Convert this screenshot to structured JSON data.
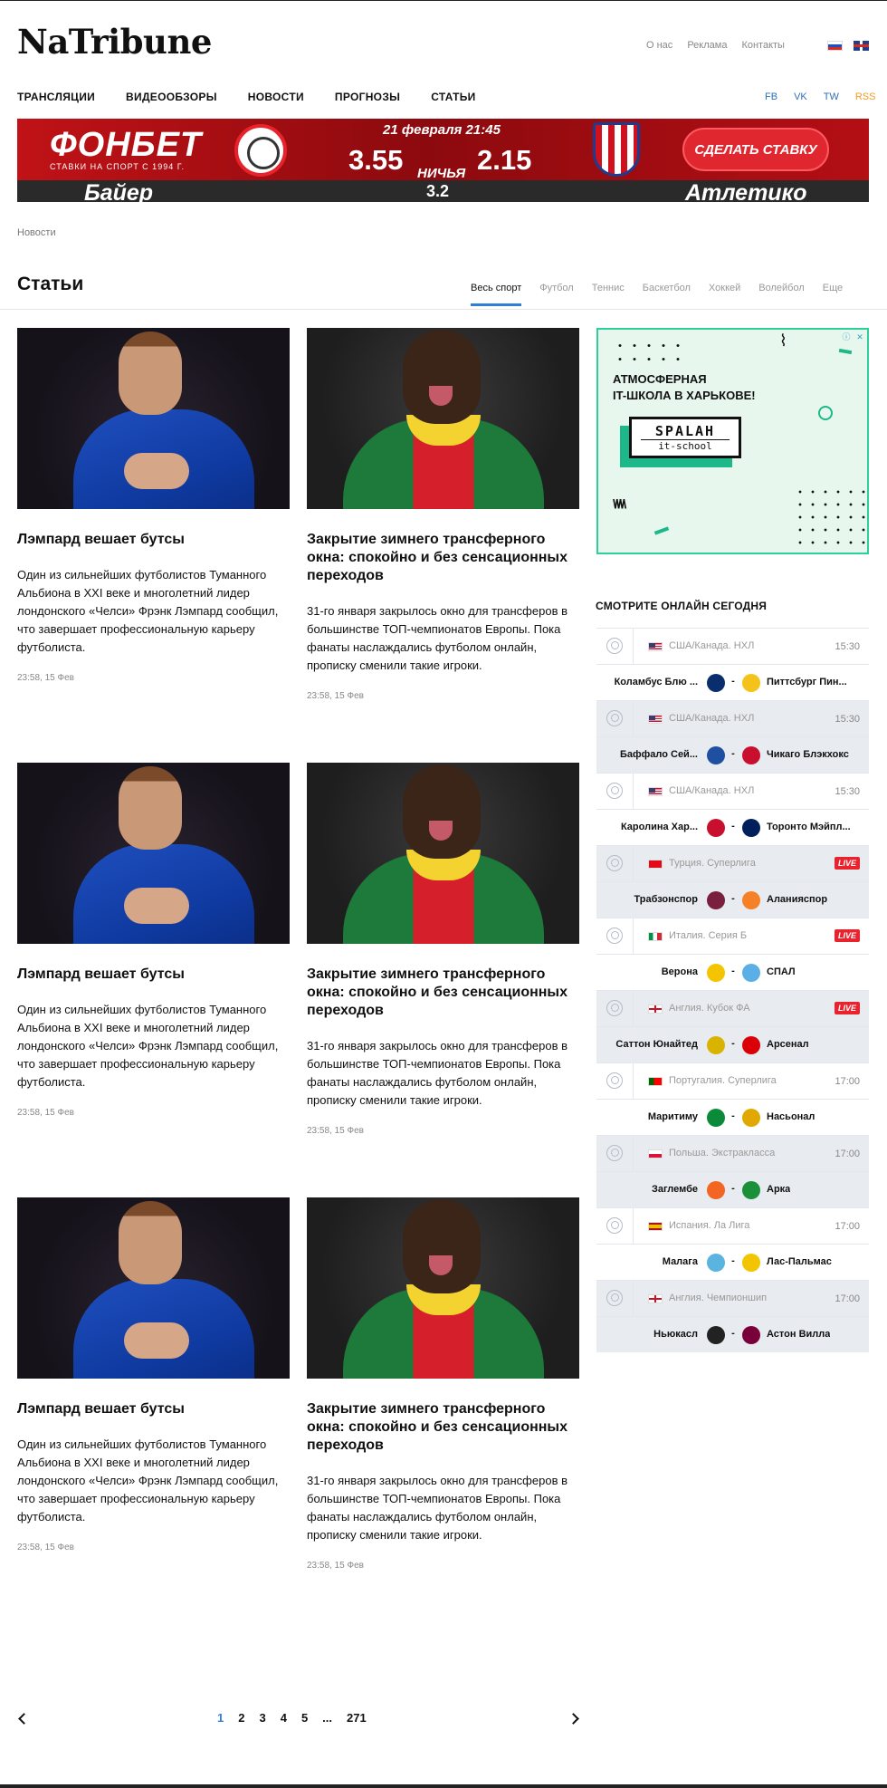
{
  "site": {
    "logo": "NaTribune"
  },
  "toplinks": [
    "О нас",
    "Реклама",
    "Контакты"
  ],
  "languages": [
    "ru-flag",
    "en-flag"
  ],
  "nav": [
    "ТРАНСЛЯЦИИ",
    "ВИДЕООБЗОРЫ",
    "НОВОСТИ",
    "ПРОГНОЗЫ",
    "СТАТЬИ"
  ],
  "social": {
    "fb": "FB",
    "vk": "VK",
    "tw": "TW",
    "rss": "RSS"
  },
  "colors": {
    "accent": "#2f7fd8",
    "live": "#e8232e",
    "rss": "#f29a1f",
    "social": "#2f6fb5",
    "ad_border": "#2fcf9c"
  },
  "banner": {
    "brand": "ФОНБЕТ",
    "sub": "СТАВКИ НА СПОРТ С 1994 Г.",
    "date": "21 февраля 21:45",
    "odd_home": "3.55",
    "odd_away": "2.15",
    "draw_label": "НИЧЬЯ",
    "draw_odd": "3.2",
    "team_home": "Байер",
    "team_away": "Атлетико",
    "cta": "СДЕЛАТЬ СТАВКУ"
  },
  "breadcrumb": "Новости",
  "section": {
    "title": "Статьи",
    "tabs": [
      "Весь спорт",
      "Футбол",
      "Теннис",
      "Баскетбол",
      "Хоккей",
      "Волейбол",
      "Еще"
    ]
  },
  "articles": [
    {
      "image": "lampard-photo",
      "title": "Лэмпард вешает бутсы",
      "text": "Один из сильнейших футболистов Туманного Альбиона в XXI веке и многолетний лидер лондонского «Челси» Фрэнк Лэмпард сообщил, что завершает профессиональную карьеру футболиста.",
      "time": "23:58, 15 Фев"
    },
    {
      "image": "footballer-photo",
      "title": "Закрытие зимнего трансферного окна: спокойно и без сенсационных переходов",
      "text": "31-го января закрылось окно для трансферов в большинстве ТОП-чемпионатов Европы. Пока фанаты наслаждались футболом онлайн, прописку сменили такие игроки.",
      "time": "23:58, 15 Фев"
    },
    {
      "image": "lampard-photo",
      "title": "Лэмпард вешает бутсы",
      "text": "Один из сильнейших футболистов Туманного Альбиона в XXI веке и многолетний лидер лондонского «Челси» Фрэнк Лэмпард сообщил, что завершает профессиональную карьеру футболиста.",
      "time": "23:58, 15 Фев"
    },
    {
      "image": "footballer-photo",
      "title": "Закрытие зимнего трансферного окна: спокойно и без сенсационных переходов",
      "text": "31-го января закрылось окно для трансферов в большинстве ТОП-чемпионатов Европы. Пока фанаты наслаждались футболом онлайн, прописку сменили такие игроки.",
      "time": "23:58, 15 Фев"
    },
    {
      "image": "lampard-photo",
      "title": "Лэмпард вешает бутсы",
      "text": "Один из сильнейших футболистов Туманного Альбиона в XXI веке и многолетний лидер лондонского «Челси» Фрэнк Лэмпард сообщил, что завершает профессиональную карьеру футболиста.",
      "time": "23:58, 15 Фев"
    },
    {
      "image": "footballer-photo",
      "title": "Закрытие зимнего трансферного окна: спокойно и без сенсационных переходов",
      "text": "31-го января закрылось окно для трансферов в большинстве ТОП-чемпионатов Европы. Пока фанаты наслаждались футболом онлайн, прописку сменили такие игроки.",
      "time": "23:58, 15 Фев"
    }
  ],
  "ad": {
    "headline_1": "АТМОСФЕРНАЯ",
    "headline_2": "IT-ШКОЛА В ХАРЬКОВЕ!",
    "logo_line1": "SPALAH",
    "logo_line2": "it-school"
  },
  "live": {
    "title": "СМОТРИТЕ ОНЛАЙН СЕГОДНЯ",
    "live_label": "LIVE",
    "matches": [
      {
        "sport": "hockey-icon",
        "flag": "us",
        "league": "США/Канада. НХЛ",
        "time": "15:30",
        "home": "Коламбус Блю ...",
        "away": "Питтсбург Пин...",
        "home_color": "#0a2d6e",
        "away_color": "#f4c21b"
      },
      {
        "sport": "hockey-icon",
        "flag": "us",
        "league": "США/Канада. НХЛ",
        "time": "15:30",
        "home": "Баффало Сей...",
        "away": "Чикаго Блэкхокс",
        "home_color": "#1f4fa0",
        "away_color": "#c8102e"
      },
      {
        "sport": "hockey-icon",
        "flag": "us",
        "league": "США/Канада. НХЛ",
        "time": "15:30",
        "home": "Каролина Хар...",
        "away": "Торонто Мэйпл...",
        "home_color": "#c8102e",
        "away_color": "#00205b"
      },
      {
        "sport": "football-icon",
        "flag": "tr",
        "league": "Турция. Суперлига",
        "live": true,
        "home": "Трабзонспор",
        "away": "Аланияспор",
        "home_color": "#7a1f3d",
        "away_color": "#f58025"
      },
      {
        "sport": "football-icon",
        "flag": "it",
        "league": "Италия. Серия Б",
        "live": true,
        "home": "Верона",
        "away": "СПАЛ",
        "home_color": "#f5c400",
        "away_color": "#5ab0e6"
      },
      {
        "sport": "football-icon",
        "flag": "en",
        "league": "Англия. Кубок ФА",
        "live": true,
        "home": "Саттон Юнайтед",
        "away": "Арсенал",
        "home_color": "#d8b400",
        "away_color": "#db0007"
      },
      {
        "sport": "football-icon",
        "flag": "pt",
        "league": "Португалия. Суперлига",
        "time": "17:00",
        "home": "Маритиму",
        "away": "Насьонал",
        "home_color": "#0b8a3a",
        "away_color": "#e0a800"
      },
      {
        "sport": "football-icon",
        "flag": "pl",
        "league": "Польша. Экстракласса",
        "time": "17:00",
        "home": "Заглембе",
        "away": "Арка",
        "home_color": "#f26522",
        "away_color": "#1b8f3a"
      },
      {
        "sport": "football-icon",
        "flag": "es",
        "league": "Испания. Ла Лига",
        "time": "17:00",
        "home": "Малага",
        "away": "Лас-Пальмас",
        "home_color": "#59b4e0",
        "away_color": "#f2c500"
      },
      {
        "sport": "football-icon",
        "flag": "en",
        "league": "Англия. Чемпионшип",
        "time": "17:00",
        "home": "Ньюкасл",
        "away": "Астон Вилла",
        "home_color": "#222222",
        "away_color": "#7a003c"
      }
    ]
  },
  "pagination": {
    "pages": [
      "1",
      "2",
      "3",
      "4",
      "5"
    ],
    "ellipsis": "...",
    "last": "271",
    "current": "1"
  }
}
